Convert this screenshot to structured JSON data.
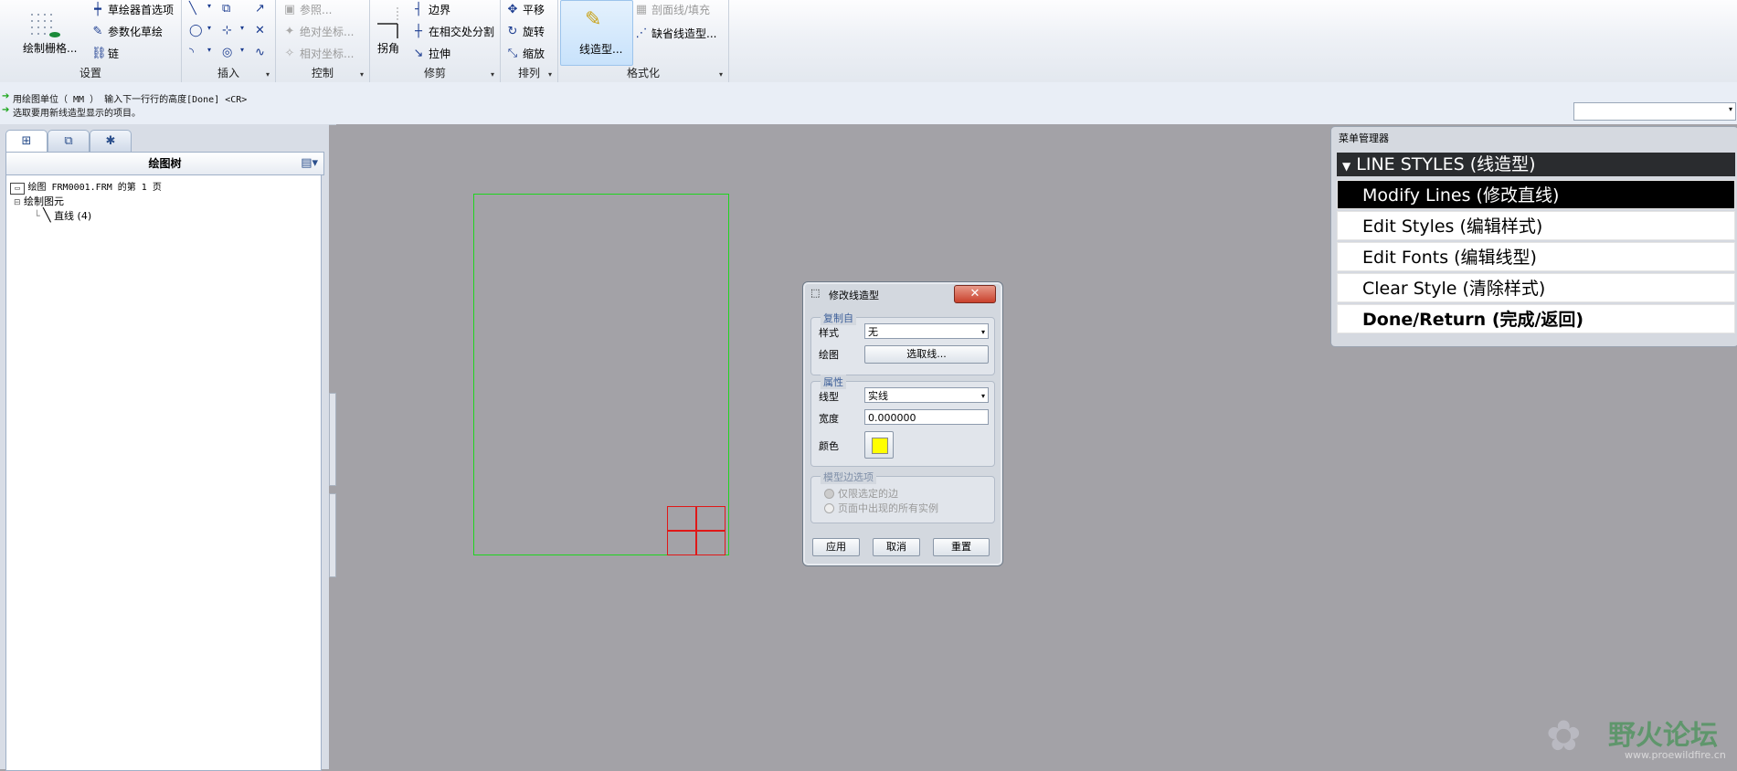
{
  "ribbon": {
    "groups": [
      {
        "label": "设置"
      },
      {
        "label": "插入"
      },
      {
        "label": "控制"
      },
      {
        "label": "修剪"
      },
      {
        "label": "排列"
      },
      {
        "label": "格式化"
      }
    ],
    "setup": {
      "sketch_grid": "绘制栅格...",
      "sketcher_prefs": "草绘器首选项",
      "parametric_sketch": "参数化草绘",
      "chain": "链"
    },
    "control": {
      "reference": "参照...",
      "absolute_coord": "绝对坐标...",
      "relative_coord": "相对坐标..."
    },
    "trim": {
      "corner": "拐角",
      "boundary": "边界",
      "split_at_intersect": "在相交处分割",
      "stretch": "拉伸"
    },
    "arrange": {
      "translate": "平移",
      "rotate": "旋转",
      "scale": "缩放"
    },
    "format": {
      "line_style": "线造型...",
      "hatch_fill": "剖面线/填充",
      "default_line_style": "缺省线造型..."
    }
  },
  "messages": [
    "用绘图单位（ MM ） 输入下一行行的高度[Done]   <CR>",
    "选取要用新线造型显示的项目。"
  ],
  "left_panel": {
    "tree_title": "绘图树",
    "tree_items": [
      {
        "label": "绘图 FRM0001.FRM 的第 1 页"
      },
      {
        "label": "绘制图元"
      },
      {
        "label": "直线  (4)"
      }
    ]
  },
  "dialog": {
    "title": "修改线造型",
    "copy_from": {
      "legend": "复制自",
      "style_label": "样式",
      "style_value": "无",
      "drawing_label": "绘图",
      "select_line_button": "选取线..."
    },
    "attributes": {
      "legend": "属性",
      "linetype_label": "线型",
      "linetype_value": "实线",
      "width_label": "宽度",
      "width_value": "0.000000",
      "color_label": "颜色",
      "color_value": "#ffff00"
    },
    "model_edge_options": {
      "legend": "模型边选项",
      "option1": "仅限选定的边",
      "option2": "页面中出现的所有实例"
    },
    "buttons": {
      "apply": "应用",
      "cancel": "取消",
      "reset": "重置"
    }
  },
  "menu_manager": {
    "title": "菜单管理器",
    "header": "LINE STYLES (线造型)",
    "items": [
      {
        "label": "Modify Lines (修改直线)"
      },
      {
        "label": "Edit Styles (编辑样式)"
      },
      {
        "label": "Edit Fonts (编辑线型)"
      },
      {
        "label": "Clear Style (清除样式)"
      },
      {
        "label": "Done/Return (完成/返回)"
      }
    ]
  },
  "watermark": {
    "text": "野火论坛",
    "url_text": "www.proewildfire.cn"
  },
  "colors": {
    "frame_green": "#1fd51f",
    "grid_red": "#e01818",
    "menu_selected": "#000000",
    "canvas_bg": "#a3a2a7"
  }
}
